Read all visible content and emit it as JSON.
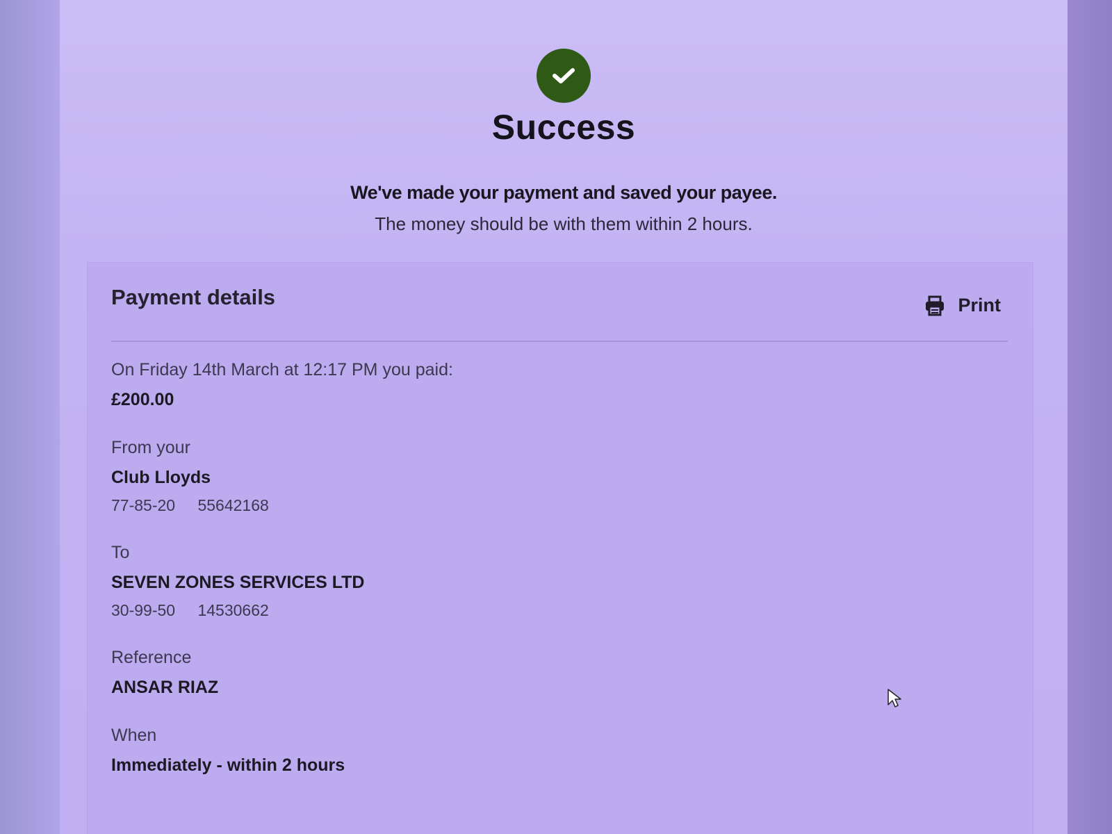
{
  "confirmation": {
    "title": "Success",
    "message_strong": "We've made your payment and saved your payee.",
    "message_sub": "The money should be with them within 2 hours."
  },
  "payment_details": {
    "heading": "Payment details",
    "print_label": "Print",
    "paid_intro": "On Friday 14th March at 12:17 PM you paid:",
    "amount": "£200.00",
    "from_label": "From your",
    "from_account_name": "Club Lloyds",
    "from_sort_code": "77-85-20",
    "from_account_number": "55642168",
    "to_label": "To",
    "to_name": "SEVEN ZONES SERVICES LTD",
    "to_sort_code": "30-99-50",
    "to_account_number": "14530662",
    "reference_label": "Reference",
    "reference_value": "ANSAR RIAZ",
    "when_label": "When",
    "when_value": "Immediately - within 2 hours"
  },
  "icons": {
    "success": "check-icon",
    "print": "printer-icon",
    "cursor": "mouse-pointer-icon"
  },
  "colors": {
    "success_green": "#2f5a16"
  }
}
